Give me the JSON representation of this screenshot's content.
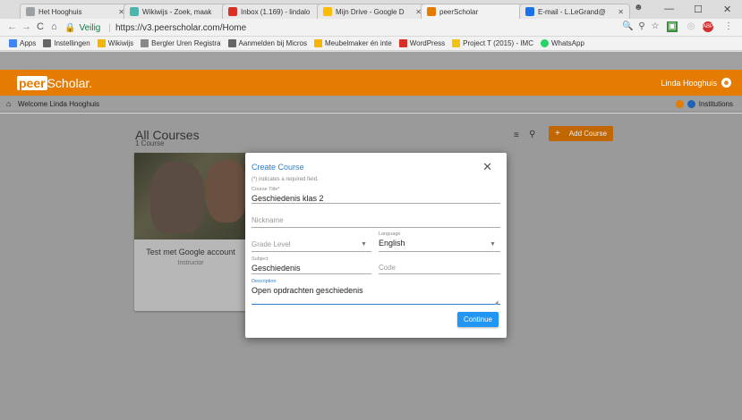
{
  "browser": {
    "tabs": [
      {
        "label": "Het Hooghuis",
        "color": "#9aa0a6"
      },
      {
        "label": "Wikiwijs - Zoek, maak",
        "color": "#4db6ac"
      },
      {
        "label": "Inbox (1.169) - lindalo",
        "color": "#d93025"
      },
      {
        "label": "Mijn Drive - Google D",
        "color": "#fbbc04"
      },
      {
        "label": "peerScholar",
        "color": "#e57b00"
      },
      {
        "label": "E-mail - L.LeGrand@",
        "color": "#1a73e8"
      }
    ],
    "secure_label": "Veilig",
    "url": "https://v3.peerscholar.com/Home",
    "bookmarks": [
      {
        "label": "Apps",
        "color": "#4285f4"
      },
      {
        "label": "Instellingen",
        "color": "#666666"
      },
      {
        "label": "Wikiwijs",
        "color": "#f4b400"
      },
      {
        "label": "Bergler Uren Registra",
        "color": "#888888"
      },
      {
        "label": "Aanmelden bij Micros",
        "color": "#666666"
      },
      {
        "label": "Meubelmaker én inte",
        "color": "#f4b400"
      },
      {
        "label": "WordPress",
        "color": "#d93025"
      },
      {
        "label": "Project T (2015) - IMC",
        "color": "#f4c20d"
      },
      {
        "label": "WhatsApp",
        "color": "#25d366"
      }
    ]
  },
  "app": {
    "logo_peer": "peer",
    "logo_rest": "Scholar.",
    "user_name": "Linda Hooghuis",
    "welcome": "Welcome Linda Hooghuis",
    "institutions": "Institutions",
    "accent": "#e57b00"
  },
  "courses": {
    "title": "All Courses",
    "count": "1 Course",
    "add_label": "Add Course",
    "card_title": "Test met Google account",
    "card_role": "Instructor"
  },
  "modal": {
    "title": "Create Course",
    "required_note": "(*) indicates a required field.",
    "course_title_label": "Course Title*",
    "course_title_value": "Geschiedenis klas 2",
    "nickname_placeholder": "Nickname",
    "grade_placeholder": "Grade Level",
    "language_label": "Language",
    "language_value": "English",
    "subject_label": "Subject",
    "subject_value": "Geschiedenis",
    "code_placeholder": "Code",
    "description_label": "Description",
    "description_value": "Open opdrachten geschiedenis",
    "continue_label": "Continue"
  }
}
